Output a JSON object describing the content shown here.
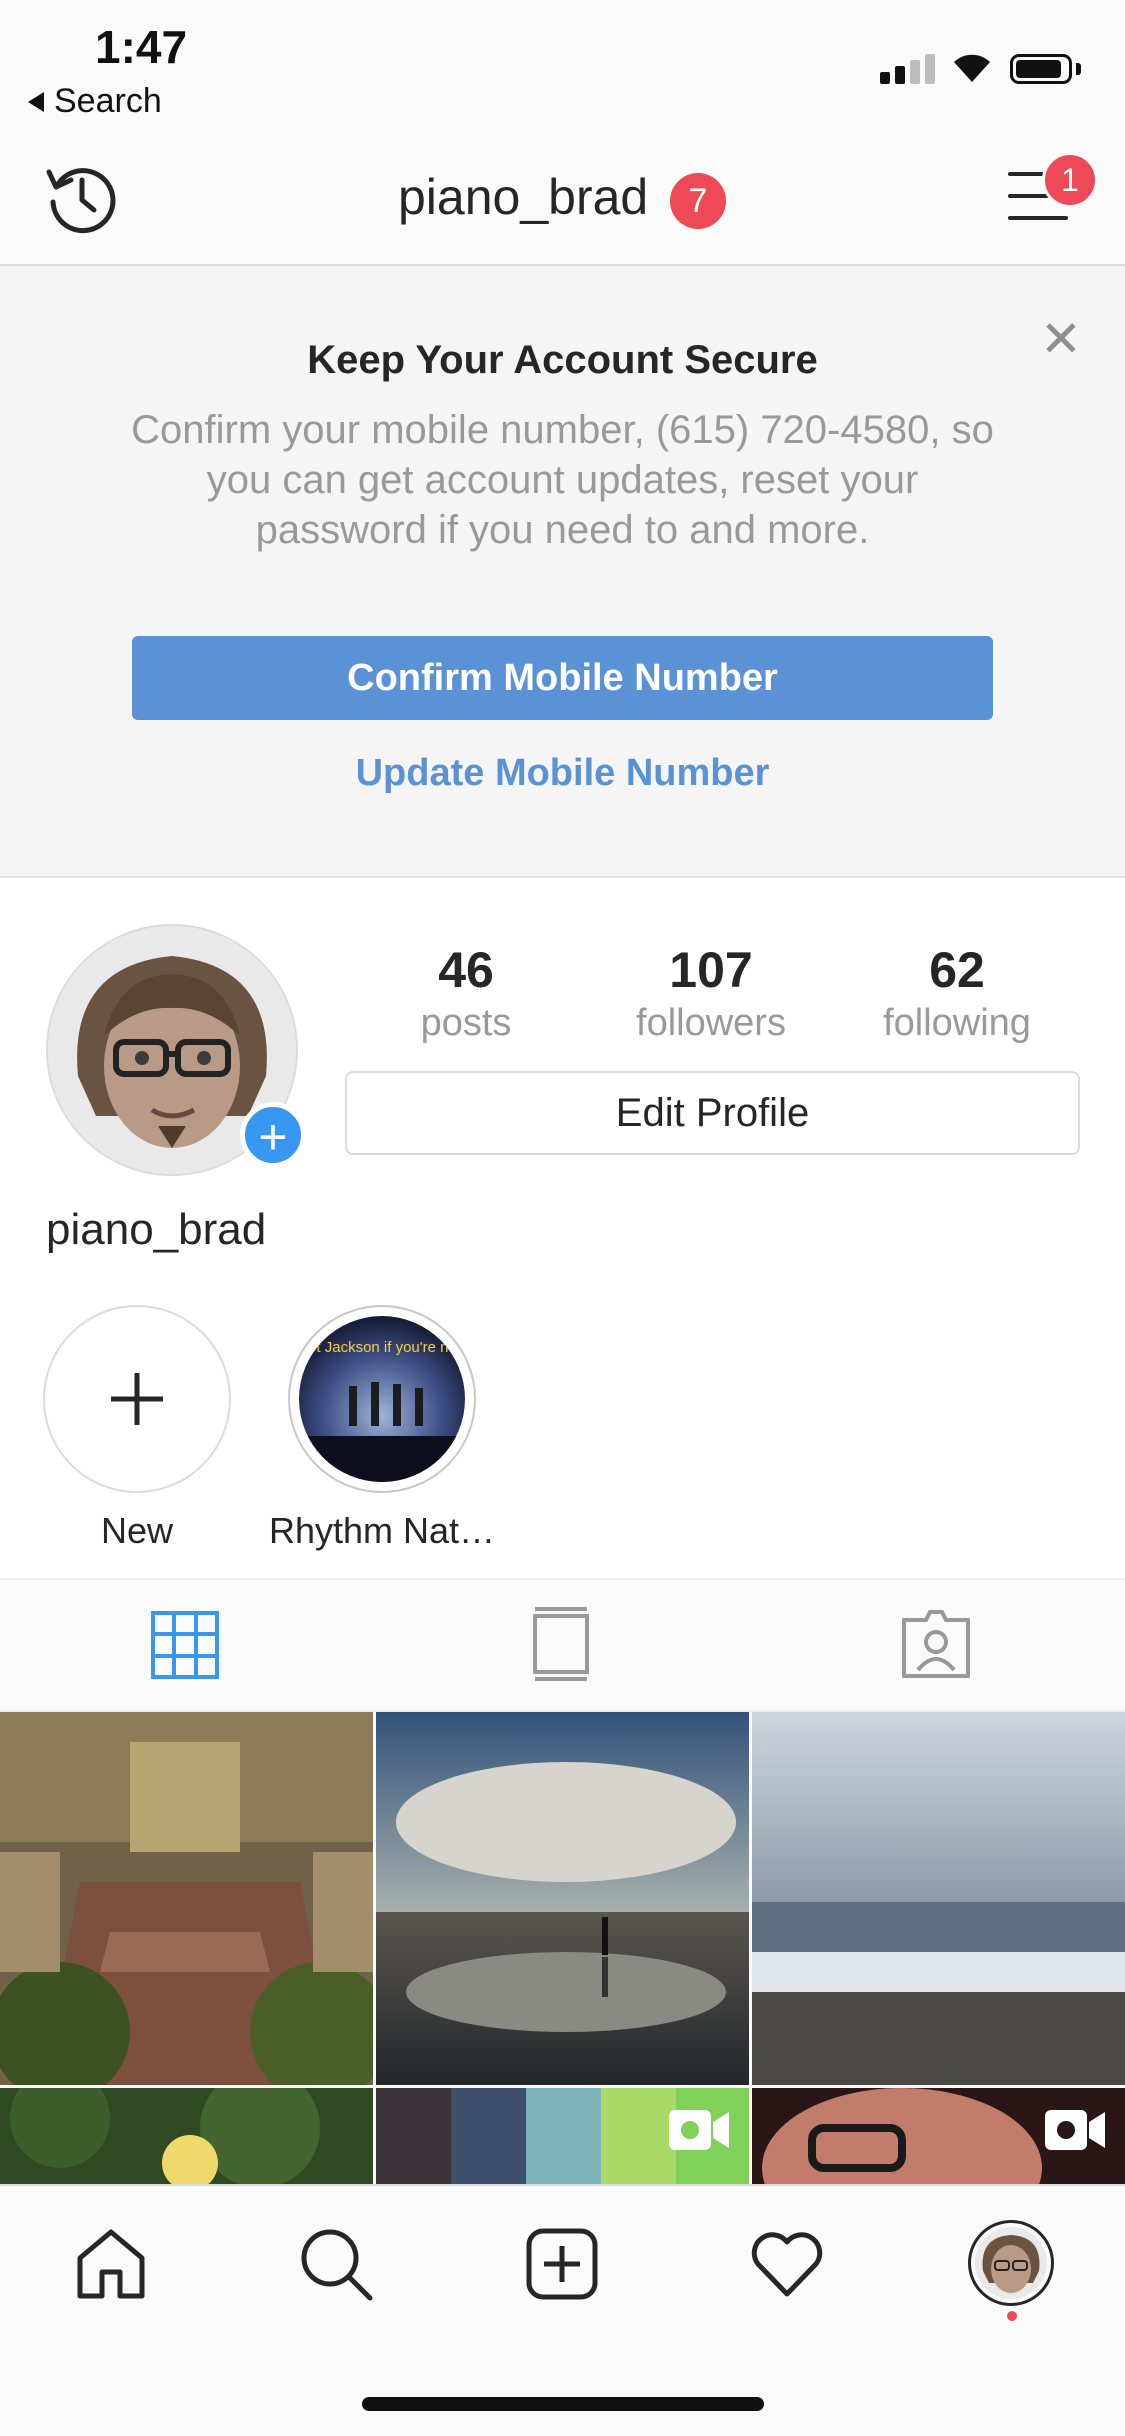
{
  "status_bar": {
    "time": "1:47",
    "back_label": "Search"
  },
  "header": {
    "username": "piano_brad",
    "notifications_badge": "7",
    "menu_badge": "1"
  },
  "secure_panel": {
    "title": "Keep Your Account Secure",
    "body": "Confirm your mobile number, (615) 720-4580, so you can get account updates, reset your password if you need to and more.",
    "confirm_label": "Confirm Mobile Number",
    "update_label": "Update Mobile Number",
    "close_glyph": "✕"
  },
  "profile": {
    "stats": [
      {
        "num": "46",
        "label": "posts"
      },
      {
        "num": "107",
        "label": "followers"
      },
      {
        "num": "62",
        "label": "following"
      }
    ],
    "edit_label": "Edit Profile",
    "name": "piano_brad"
  },
  "highlights": [
    {
      "label": "New"
    },
    {
      "label": "Rhythm Nat…",
      "caption": "Janet Jackson if you're nasty!"
    }
  ],
  "tabs": [
    {
      "name": "grid",
      "icon": "grid-icon",
      "active": true
    },
    {
      "name": "feed",
      "icon": "feed-icon",
      "active": false
    },
    {
      "name": "tagged",
      "icon": "tagged-user-icon",
      "active": false
    }
  ],
  "colors": {
    "accent": "#3897f0",
    "confirm_button": "#5b92d5",
    "badge": "#ed4956"
  }
}
